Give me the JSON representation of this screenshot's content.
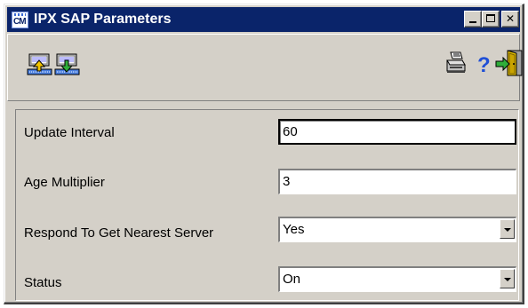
{
  "window": {
    "title": "IPX SAP Parameters",
    "app_icon_text": "CM",
    "controls": {
      "minimize": "minimize",
      "maximize": "maximize",
      "close": "✕"
    }
  },
  "toolbar": {
    "items": [
      {
        "name": "upload-icon",
        "icon": "upload-to-device"
      },
      {
        "name": "download-icon",
        "icon": "download-from-device"
      },
      {
        "name": "print-icon",
        "icon": "printer"
      },
      {
        "name": "help-icon",
        "icon": "question-mark",
        "glyph": "?"
      },
      {
        "name": "exit-icon",
        "icon": "exit-door"
      }
    ]
  },
  "form": {
    "update_interval": {
      "label": "Update Interval",
      "value": "60"
    },
    "age_multiplier": {
      "label": "Age Multiplier",
      "value": "3"
    },
    "respond_nearest": {
      "label": "Respond To Get Nearest Server",
      "value": "Yes"
    },
    "status": {
      "label": "Status",
      "value": "On"
    }
  },
  "colors": {
    "titlebar": "#0a246a",
    "face": "#d4d0c8",
    "help_blue": "#1f4fd6"
  }
}
